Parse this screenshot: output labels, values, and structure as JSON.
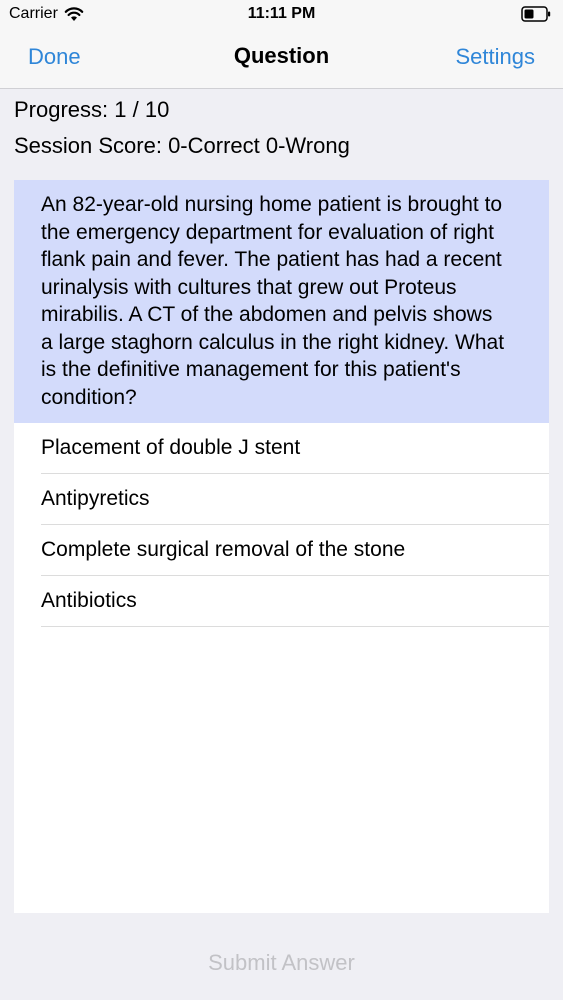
{
  "status_bar": {
    "carrier": "Carrier",
    "time": "11:11 PM"
  },
  "nav": {
    "left_label": "Done",
    "title": "Question",
    "right_label": "Settings",
    "accent_color": "#2f86d8"
  },
  "info": {
    "progress": "Progress: 1 / 10",
    "session_score": "Session Score: 0-Correct 0-Wrong"
  },
  "question": {
    "text": "An 82-year-old nursing home patient is brought to the emergency department for evaluation of right flank pain and fever. The patient has had a recent urinalysis with cultures that grew out Proteus mirabilis. A CT of the abdomen and pelvis shows a large staghorn calculus in the right kidney. What is the definitive management for this patient's condition?",
    "highlight_color": "#d3dbfb"
  },
  "answers": [
    {
      "label": "Placement of double J stent"
    },
    {
      "label": "Antipyretics"
    },
    {
      "label": "Complete surgical removal of the stone"
    },
    {
      "label": "Antibiotics"
    }
  ],
  "submit_label": "Submit Answer"
}
